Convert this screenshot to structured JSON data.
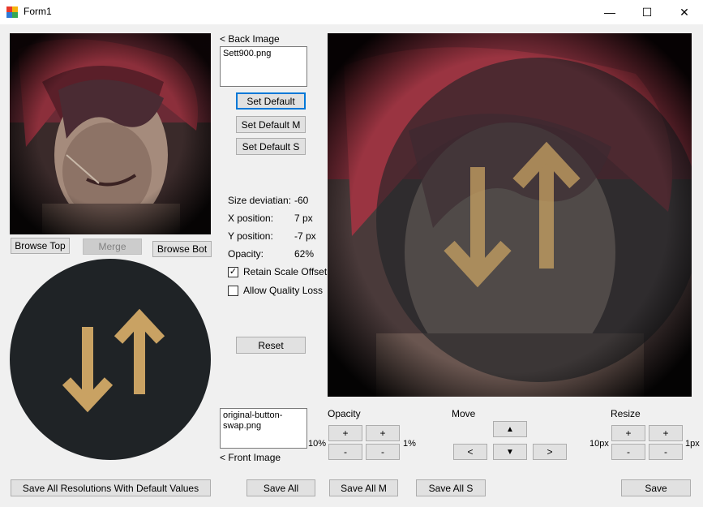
{
  "window": {
    "title": "Form1",
    "minimize_glyph": "—",
    "maximize_glyph": "☐",
    "close_glyph": "✕"
  },
  "back_image": {
    "label": "< Back Image",
    "filename": "Sett900.png"
  },
  "front_image": {
    "label": "< Front Image",
    "filename": "original-button-swap.png"
  },
  "buttons": {
    "set_default": "Set Default",
    "set_default_m": "Set Default M",
    "set_default_s": "Set Default S",
    "browse_top": "Browse Top",
    "merge": "Merge",
    "browse_bot": "Browse Bot",
    "reset": "Reset",
    "save_all_default": "Save All Resolutions With Default Values",
    "save_all": "Save All",
    "save_all_m": "Save All M",
    "save_all_s": "Save All S",
    "save": "Save"
  },
  "stats": {
    "size_deviation_label": "Size deviatian:",
    "size_deviation_value": "-60",
    "x_position_label": "X position:",
    "x_position_value": "7 px",
    "y_position_label": "Y position:",
    "y_position_value": "-7 px",
    "opacity_label": "Opacity:",
    "opacity_value": "62%"
  },
  "options": {
    "retain_scale_offset": {
      "label": "Retain Scale Offset",
      "checked": true
    },
    "allow_quality_loss": {
      "label": "Allow Quality Loss",
      "checked": false
    }
  },
  "opacity_controls": {
    "label": "Opacity",
    "step_large": "10%",
    "step_small": "1%",
    "plus": "+",
    "minus": "-"
  },
  "move_controls": {
    "label": "Move",
    "up": "▲",
    "down": "▼",
    "left": "<",
    "right": ">"
  },
  "resize_controls": {
    "label": "Resize",
    "step_large": "10px",
    "step_small": "1px",
    "plus": "+",
    "minus": "-"
  },
  "colors": {
    "accent": "#0078d7",
    "button_face": "#e1e1e1",
    "icon_gold": "#c9a263",
    "icon_bg": "#1f2326"
  }
}
